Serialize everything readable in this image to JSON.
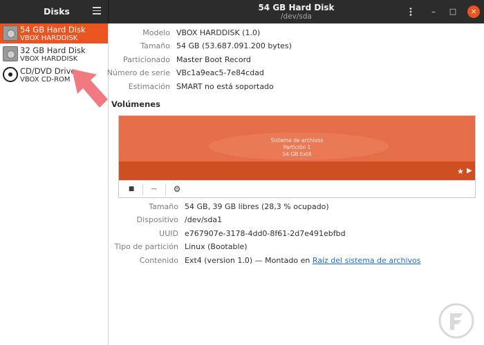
{
  "window": {
    "app_title": "Disks",
    "title": "54 GB Hard Disk",
    "subtitle": "/dev/sda",
    "minimize_glyph": "–",
    "maximize_glyph": "□",
    "close_glyph": "×"
  },
  "sidebar": {
    "items": [
      {
        "name": "54 GB Hard Disk",
        "sub": "VBOX HARDDISK",
        "icon": "hard-disk-icon",
        "selected": true
      },
      {
        "name": "32 GB Hard Disk",
        "sub": "VBOX HARDDISK",
        "icon": "hard-disk-icon",
        "selected": false
      },
      {
        "name": "CD/DVD Drive",
        "sub": "VBOX CD-ROM",
        "icon": "optical-disc-icon",
        "selected": false
      }
    ]
  },
  "disk": {
    "rows": [
      {
        "label": "Modelo",
        "value": "VBOX HARDDISK (1.0)"
      },
      {
        "label": "Tamaño",
        "value": "54 GB (53.687.091.200 bytes)"
      },
      {
        "label": "Particionado",
        "value": "Master Boot Record"
      },
      {
        "label": "Número de serie",
        "value": "VBc1a9eac5-7e84cdad"
      },
      {
        "label": "Estimación",
        "value": "SMART no está soportado"
      }
    ]
  },
  "volumes": {
    "title": "Volúmenes",
    "partition": {
      "line1": "Sistema de archivos",
      "line2": "Partición 1",
      "line3": "54 GB Ext4"
    },
    "tools": {
      "stop_glyph": "■",
      "remove_glyph": "—",
      "settings_glyph": "⚙"
    }
  },
  "partition": {
    "rows": [
      {
        "label": "Tamaño",
        "value": "54 GB, 39 GB libres (28,3 % ocupado)"
      },
      {
        "label": "Dispositivo",
        "value": "/dev/sda1"
      },
      {
        "label": "UUID",
        "value": "e767907e-3178-4dd0-8f61-2d7e491ebfbd"
      },
      {
        "label": "Tipo de partición",
        "value": "Linux (Bootable)"
      },
      {
        "label": "Contenido",
        "value": "Ext4 (version 1.0) — Montado en ",
        "link": "Raíz del sistema de archivos"
      }
    ]
  },
  "colors": {
    "accent": "#e95420",
    "header": "#2c2c2c",
    "arrow": "#f07a80",
    "link": "#1c6ecf"
  }
}
